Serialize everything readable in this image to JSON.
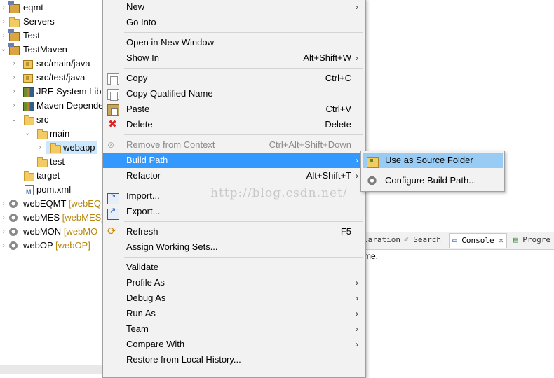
{
  "tree": {
    "items": [
      {
        "label": "eqmt",
        "deco": "",
        "icon": "project-icon"
      },
      {
        "label": "Servers",
        "deco": "",
        "icon": "folder-icon"
      },
      {
        "label": "Test",
        "deco": "",
        "icon": "project-icon"
      },
      {
        "label": "TestMaven",
        "deco": "",
        "icon": "project-icon"
      },
      {
        "label": "src/main/java",
        "deco": "",
        "icon": "package-folder-icon"
      },
      {
        "label": "src/test/java",
        "deco": "",
        "icon": "package-folder-icon"
      },
      {
        "label": "JRE System Libra",
        "deco": "",
        "icon": "library-icon"
      },
      {
        "label": "Maven Depende",
        "deco": "",
        "icon": "library-icon"
      },
      {
        "label": "src",
        "deco": "",
        "icon": "folder-icon"
      },
      {
        "label": "main",
        "deco": "",
        "icon": "folder-icon"
      },
      {
        "label": "webapp",
        "deco": "",
        "icon": "folder-icon"
      },
      {
        "label": "test",
        "deco": "",
        "icon": "folder-icon"
      },
      {
        "label": "target",
        "deco": "",
        "icon": "folder-icon"
      },
      {
        "label": "pom.xml",
        "deco": "",
        "icon": "xml-file-icon"
      },
      {
        "label": "webEQMT",
        "deco": "[webEQM",
        "icon": "web-project-icon"
      },
      {
        "label": "webMES",
        "deco": "[webMES]",
        "icon": "web-project-icon"
      },
      {
        "label": "webMON",
        "deco": "[webMO",
        "icon": "web-project-icon"
      },
      {
        "label": "webOP",
        "deco": "[webOP]",
        "icon": "web-project-icon"
      }
    ]
  },
  "menu": {
    "items": [
      {
        "label": "New",
        "accel": "",
        "arrow": "›"
      },
      {
        "label": "Go Into",
        "accel": "",
        "arrow": ""
      },
      {
        "label": "Open in New Window",
        "accel": "",
        "arrow": ""
      },
      {
        "label": "Show In",
        "accel": "Alt+Shift+W",
        "arrow": "›"
      },
      {
        "label": "Copy",
        "accel": "Ctrl+C",
        "arrow": ""
      },
      {
        "label": "Copy Qualified Name",
        "accel": "",
        "arrow": ""
      },
      {
        "label": "Paste",
        "accel": "Ctrl+V",
        "arrow": ""
      },
      {
        "label": "Delete",
        "accel": "Delete",
        "arrow": ""
      },
      {
        "label": "Remove from Context",
        "accel": "Ctrl+Alt+Shift+Down",
        "arrow": ""
      },
      {
        "label": "Build Path",
        "accel": "",
        "arrow": "›"
      },
      {
        "label": "Refactor",
        "accel": "Alt+Shift+T",
        "arrow": "›"
      },
      {
        "label": "Import...",
        "accel": "",
        "arrow": ""
      },
      {
        "label": "Export...",
        "accel": "",
        "arrow": ""
      },
      {
        "label": "Refresh",
        "accel": "F5",
        "arrow": ""
      },
      {
        "label": "Assign Working Sets...",
        "accel": "",
        "arrow": ""
      },
      {
        "label": "Validate",
        "accel": "",
        "arrow": ""
      },
      {
        "label": "Profile As",
        "accel": "",
        "arrow": "›"
      },
      {
        "label": "Debug As",
        "accel": "",
        "arrow": "›"
      },
      {
        "label": "Run As",
        "accel": "",
        "arrow": "›"
      },
      {
        "label": "Team",
        "accel": "",
        "arrow": "›"
      },
      {
        "label": "Compare With",
        "accel": "",
        "arrow": "›"
      },
      {
        "label": "Restore from Local History...",
        "accel": "",
        "arrow": ""
      }
    ],
    "highlighted": "Build Path",
    "disabled": "Remove from Context",
    "highlight_color": "#3399ff"
  },
  "submenu": {
    "items": [
      {
        "label": "Use as Source Folder"
      },
      {
        "label": "Configure Build Path..."
      }
    ]
  },
  "console": {
    "tabs": [
      {
        "label": "laration"
      },
      {
        "label": "Search"
      },
      {
        "label": "Console"
      },
      {
        "label": "Progre"
      }
    ],
    "close_glyph": "✕",
    "text": "me."
  },
  "watermark": "http://blog.csdn.net/"
}
